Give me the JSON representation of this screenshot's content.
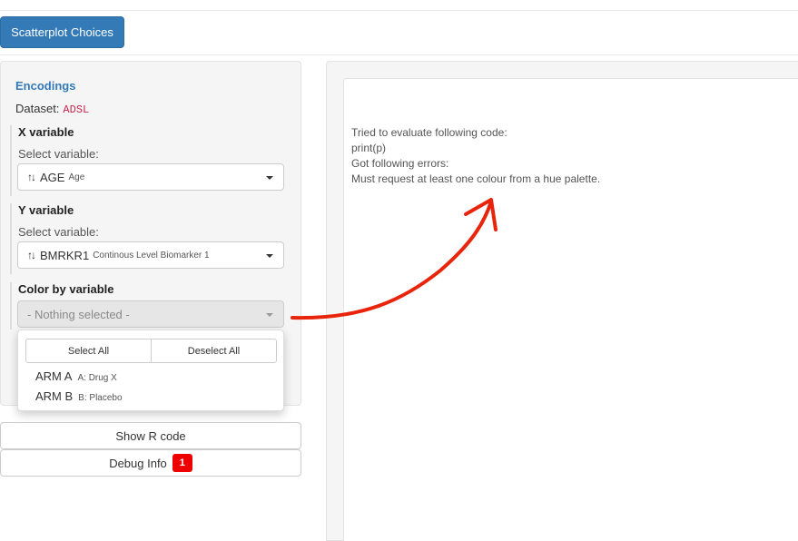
{
  "header": {
    "button_label": "Scatterplot Choices"
  },
  "encodings": {
    "title": "Encodings",
    "dataset_label": "Dataset:",
    "dataset_value": "ADSL",
    "x": {
      "title": "X variable",
      "sub": "Select variable:",
      "icon": "sort-icon",
      "value": "AGE",
      "label": "Age"
    },
    "y": {
      "title": "Y variable",
      "sub": "Select variable:",
      "icon": "sort-icon",
      "value": "BMRKR1",
      "label": "Continous Level Biomarker 1"
    },
    "color": {
      "title": "Color by variable",
      "placeholder": "- Nothing selected -",
      "select_all": "Select All",
      "deselect_all": "Deselect All",
      "options": [
        {
          "value": "ARM A",
          "label": "A: Drug X"
        },
        {
          "value": "ARM B",
          "label": "B: Placebo"
        }
      ]
    }
  },
  "actions": {
    "show_r_code": "Show R code",
    "debug_info": "Debug Info",
    "debug_count": "1"
  },
  "output": {
    "lines": [
      "Tried to evaluate following code:",
      "print(p)",
      "Got following errors:",
      "Must request at least one colour from a hue palette."
    ]
  },
  "colors": {
    "primary": "#337ab7",
    "annotation": "#e8250c",
    "badge": "#ee0000"
  }
}
